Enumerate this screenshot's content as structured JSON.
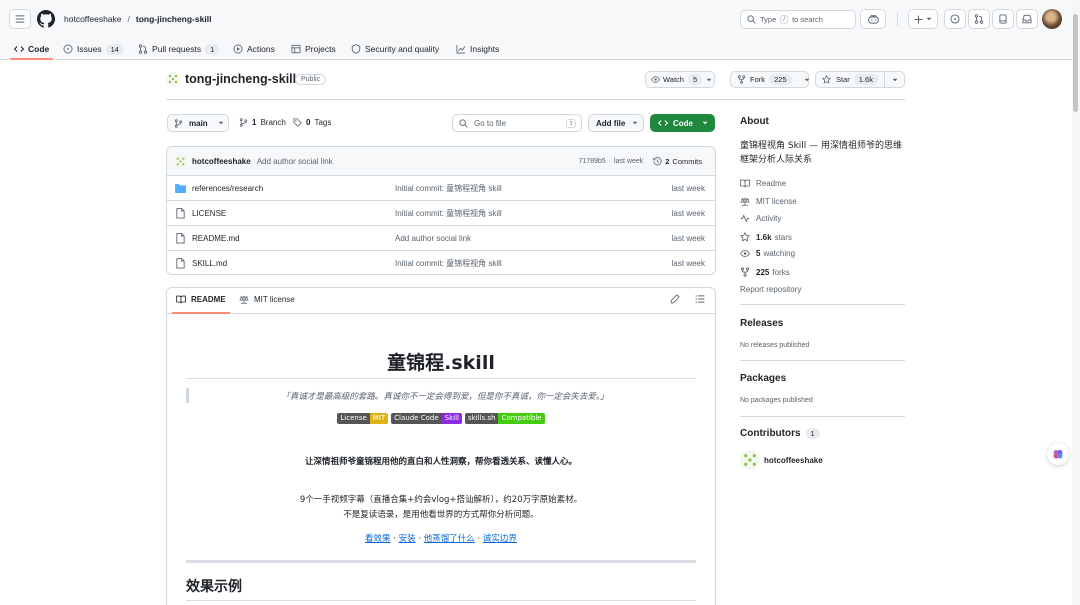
{
  "header": {
    "owner": "hotcoffeeshake",
    "repo": "tong-jincheng-skill",
    "search_label": "Type",
    "search_key": "/",
    "search_suffix": "to search"
  },
  "repo_nav": {
    "tabs": [
      {
        "label": "Code",
        "icon": "code-icon"
      },
      {
        "label": "Issues",
        "icon": "issue-icon",
        "count": "14"
      },
      {
        "label": "Pull requests",
        "icon": "pr-icon",
        "count": "1"
      },
      {
        "label": "Actions",
        "icon": "play-icon"
      },
      {
        "label": "Projects",
        "icon": "table-icon"
      },
      {
        "label": "Security and quality",
        "icon": "shield-icon"
      },
      {
        "label": "Insights",
        "icon": "graph-icon"
      }
    ]
  },
  "repo": {
    "name": "tong-jincheng-skill",
    "visibility": "Public",
    "watch_label": "Watch",
    "watch_count": "5",
    "fork_label": "Fork",
    "fork_count": "225",
    "star_label": "Star",
    "star_count": "1.6k"
  },
  "toolbar": {
    "branch": "main",
    "branches_count": "1",
    "branches_label": "Branch",
    "tags_count": "0",
    "tags_label": "Tags",
    "goto_placeholder": "Go to file",
    "goto_key": "t",
    "add_file": "Add file",
    "code_button": "Code"
  },
  "commit": {
    "author": "hotcoffeeshake",
    "message": "Add author social link",
    "hash": "71789b5",
    "sep": "·",
    "time": "last week",
    "commits_count": "2",
    "commits_label": "Commits"
  },
  "files": [
    {
      "name": "references/research",
      "type": "folder",
      "message": "Initial commit: 童锦程视角 skill",
      "time": "last week"
    },
    {
      "name": "LICENSE",
      "type": "file",
      "message": "Initial commit: 童锦程视角 skill",
      "time": "last week"
    },
    {
      "name": "README.md",
      "type": "file",
      "message": "Add author social link",
      "time": "last week"
    },
    {
      "name": "SKILL.md",
      "type": "file",
      "message": "Initial commit: 童锦程视角 skill",
      "time": "last week"
    }
  ],
  "readme": {
    "tab_readme": "README",
    "tab_license": "MIT license",
    "title": "童锦程.skill",
    "quote": "「真诚才是最高级的套路。真诚你不一定会得到爱，但是你不真诚，你一定会失去爱。」",
    "badges": [
      {
        "left": "License",
        "right": "MIT",
        "color": "#dfb317"
      },
      {
        "left": "Claude Code",
        "right": "Skill",
        "color": "#8a2be2"
      },
      {
        "left": "skills.sh",
        "right": "Compatible",
        "color": "#4c1"
      }
    ],
    "tagline": "让深情祖师爷童锦程用他的直白和人性洞察，帮你看透关系、读懂人心。",
    "desc1": "9个一手视频字幕（直播合集+约会vlog+搭讪解析），约20万字原始素材。",
    "desc2": "不是复读语录，是用他看世界的方式帮你分析问题。",
    "links": [
      "看效果",
      "安装",
      "他蒸馏了什么",
      "诚实边界"
    ],
    "link_sep": " · ",
    "section": "效果示例"
  },
  "about": {
    "title": "About",
    "description": "童锦程视角 Skill — 用深情祖师爷的思维框架分析人际关系",
    "items": [
      {
        "icon": "book-icon",
        "label": "Readme"
      },
      {
        "icon": "law-icon",
        "label": "MIT license"
      },
      {
        "icon": "pulse-icon",
        "label": "Activity"
      },
      {
        "icon": "star-icon",
        "count": "1.6k",
        "label": "stars"
      },
      {
        "icon": "eye-icon",
        "count": "5",
        "label": "watching"
      },
      {
        "icon": "fork-icon",
        "count": "225",
        "label": "forks"
      }
    ],
    "report": "Report repository",
    "releases_title": "Releases",
    "releases_text": "No releases published",
    "packages_title": "Packages",
    "packages_text": "No packages published",
    "contributors_title": "Contributors",
    "contributors_count": "1",
    "contributor": "hotcoffeeshake"
  }
}
